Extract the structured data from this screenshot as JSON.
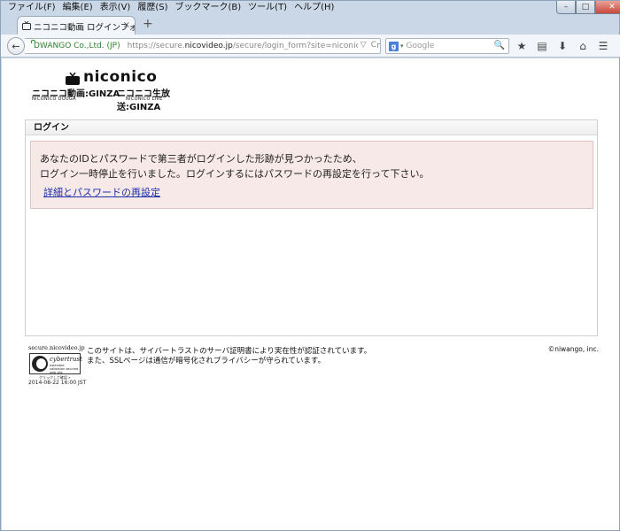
{
  "menu": [
    "ファイル(F)",
    "編集(E)",
    "表示(V)",
    "履歴(S)",
    "ブックマーク(B)",
    "ツール(T)",
    "ヘルプ(H)"
  ],
  "window_controls": {
    "minimize": "–",
    "maximize": "□",
    "close": "✕"
  },
  "tab": {
    "title": "ニコニコ動画 ログインフォ...",
    "close": "×",
    "new_tab": "+"
  },
  "navbar": {
    "back": "←",
    "identity": "DWANGO Co.,Ltd. (JP)",
    "url_scheme": "https://secure.",
    "url_host": "nicovideo.jp",
    "url_rest": "/secure/login_form?site=niconico&time=14",
    "url_dropdown": "▽",
    "url_reload": "C",
    "search_placeholder": "Google",
    "search_engine_icon": "g",
    "search_dropdown": "▾",
    "search_go": "🔍",
    "toolbar_icons": [
      "★",
      "▤",
      "⬇",
      "⌂",
      "☰"
    ]
  },
  "logo": {
    "main": "niconico",
    "sub1": "ニコニコ動画:GINZA",
    "sub1_small": "NICONICO DOUGA",
    "sub2": "ニコニコ生放送:GINZA",
    "sub2_small": "NICONICO LIVE"
  },
  "panel": {
    "heading": "ログイン",
    "message_line1": "あなたのIDとパスワードで第三者がログインした形跡が見つかったため、",
    "message_line2": "ログイン一時停止を行いました。ログインするにはパスワードの再設定を行って下さい。",
    "link": "詳細とパスワードの再設定"
  },
  "footer": {
    "seal_host": "secure.nicovideo.jp",
    "seal_brand": "cybertrust",
    "seal_subtitle": "extended validation secured web site",
    "seal_click": "クリックして確認 »",
    "seal_date": "2014-08-22 16:00 JST",
    "text_line1": "このサイトは、サイバートラストのサーバ証明書により実在性が認証されています。",
    "text_line2": "また、SSLページは通信が暗号化されプライバシーが守られています。",
    "copyright": "©niwango, inc."
  }
}
